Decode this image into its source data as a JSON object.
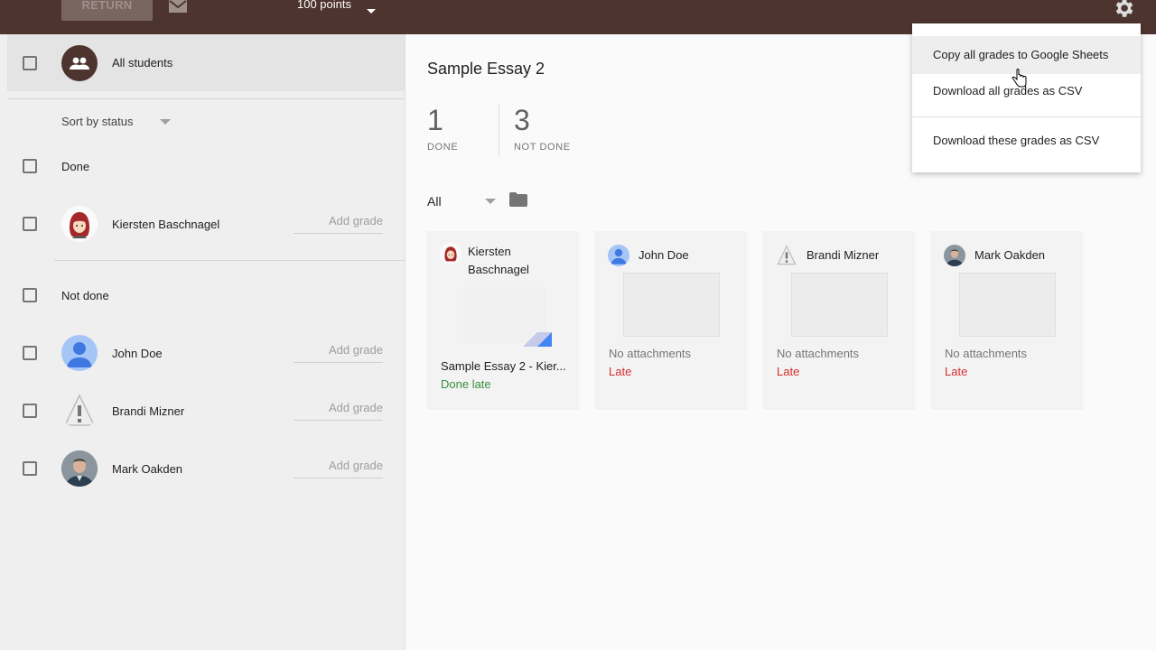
{
  "topbar": {
    "return_label": "RETURN",
    "points_label": "100 points",
    "mail_icon": "mail-icon",
    "gear_icon": "gear-icon"
  },
  "sidebar": {
    "all_students_label": "All students",
    "sort_label": "Sort by status",
    "done_group_label": "Done",
    "not_done_group_label": "Not done",
    "students": [
      {
        "name": "Kiersten Baschnagel",
        "grade_placeholder": "Add grade"
      },
      {
        "name": "John Doe",
        "grade_placeholder": "Add grade"
      },
      {
        "name": "Brandi Mizner",
        "grade_placeholder": "Add grade"
      },
      {
        "name": "Mark Oakden",
        "grade_placeholder": "Add grade"
      }
    ]
  },
  "main": {
    "title": "Sample Essay 2",
    "done_count": "1",
    "done_label": "DONE",
    "not_done_count": "3",
    "not_done_label": "NOT DONE",
    "filter_value": "All",
    "cards": [
      {
        "name_line1": "Kiersten",
        "name_line2": "Baschnagel",
        "attachment": "Sample Essay 2 - Kier...",
        "status": "Done late"
      },
      {
        "name": "John Doe",
        "attachment": "No attachments",
        "status": "Late"
      },
      {
        "name": "Brandi Mizner",
        "attachment": "No attachments",
        "status": "Late"
      },
      {
        "name": "Mark Oakden",
        "attachment": "No attachments",
        "status": "Late"
      }
    ]
  },
  "menu": {
    "items": [
      "Copy all grades to Google Sheets",
      "Download all grades as CSV",
      "Download these grades as CSV"
    ]
  },
  "colors": {
    "topbar": "#4e342e",
    "late": "#d32f2f",
    "done_late": "#388e3c"
  }
}
